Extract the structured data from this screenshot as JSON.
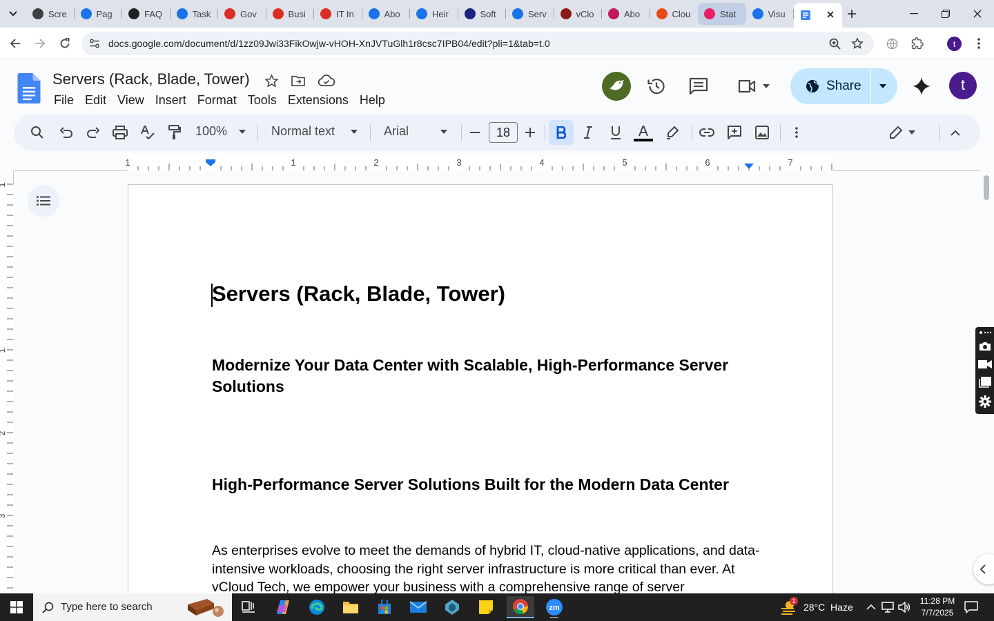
{
  "browser": {
    "tabs": [
      {
        "label": "Scre",
        "favicon_color": "#3c4043"
      },
      {
        "label": "Pag",
        "favicon_color": "#1a73e8"
      },
      {
        "label": "FAQ",
        "favicon_color": "#202124"
      },
      {
        "label": "Task",
        "favicon_color": "#1a73e8"
      },
      {
        "label": "Gov",
        "favicon_color": "#d93025"
      },
      {
        "label": "Busi",
        "favicon_color": "#d93025"
      },
      {
        "label": "IT In",
        "favicon_color": "#d93025"
      },
      {
        "label": "Abo",
        "favicon_color": "#1a73e8"
      },
      {
        "label": "Heir",
        "favicon_color": "#1a73e8"
      },
      {
        "label": "Soft",
        "favicon_color": "#1a237e"
      },
      {
        "label": "Serv",
        "favicon_color": "#1a73e8"
      },
      {
        "label": "vClo",
        "favicon_color": "#8b1a1a"
      },
      {
        "label": "Abo",
        "favicon_color": "#c2185b"
      },
      {
        "label": "Clou",
        "favicon_color": "#e64a19"
      },
      {
        "label": "Stat",
        "favicon_color": "#e91e63"
      },
      {
        "label": "Visu",
        "favicon_color": "#1a73e8"
      }
    ],
    "url": "docs.google.com/document/d/1zz09Jwi33FikOwjw-vHOH-XnJVTuGlh1r8csc7IPB04/edit?pli=1&tab=t.0",
    "profile_initial": "t"
  },
  "doc": {
    "title": "Servers (Rack, Blade, Tower)",
    "menus": [
      "File",
      "Edit",
      "View",
      "Insert",
      "Format",
      "Tools",
      "Extensions",
      "Help"
    ],
    "share_label": "Share",
    "avatar_initial": "t"
  },
  "toolbar": {
    "zoom": "100%",
    "style": "Normal text",
    "font": "Arial",
    "font_size": "18"
  },
  "ruler": {
    "labels": [
      "1",
      "1",
      "2",
      "3",
      "4",
      "5",
      "6",
      "7"
    ],
    "vertical_labels": [
      "1",
      "1",
      "2",
      "3"
    ]
  },
  "content": {
    "title": "Servers (Rack, Blade, Tower)",
    "heading1": "Modernize Your Data Center with Scalable, High-Performance Server Solutions",
    "heading2": "High-Performance Server Solutions Built for the Modern Data Center",
    "paragraph": "As enterprises evolve to meet the demands of hybrid IT, cloud-native applications, and data-intensive workloads, choosing the right server infrastructure is more critical than ever. At vCloud Tech, we empower your business with a comprehensive range of server"
  },
  "taskbar": {
    "search_placeholder": "Type here to search",
    "weather": "28°C  Haze",
    "weather_badge": "1",
    "time": "11:28 PM",
    "date": "7/7/2025"
  },
  "colors": {
    "share_bg": "#c2e7ff",
    "bold_active": "#d3e3fd",
    "avatar_bg": "#4a1b8c",
    "docs_blue": "#4285f4"
  }
}
